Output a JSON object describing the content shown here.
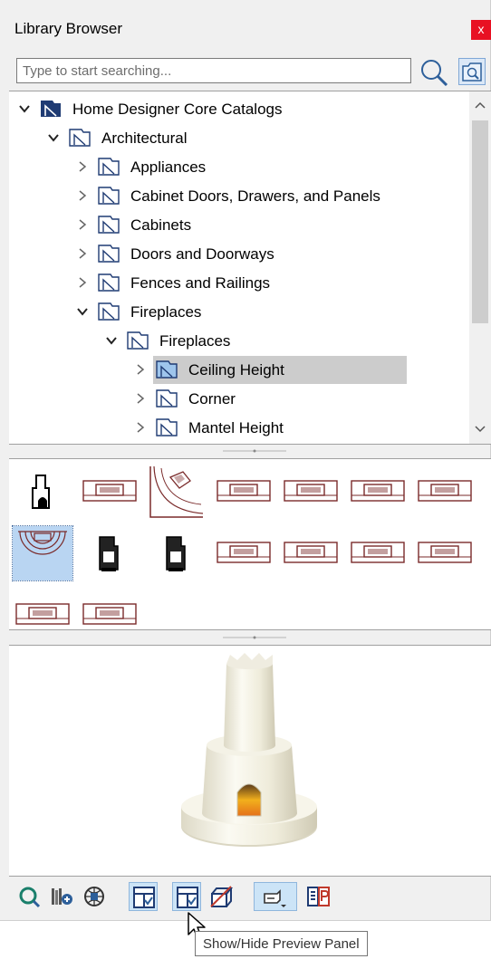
{
  "window": {
    "title": "Library Browser",
    "close_label": "x"
  },
  "search": {
    "placeholder": "Type to start searching..."
  },
  "tree": {
    "items": [
      {
        "label": "Home Designer Core Catalogs",
        "level": 0,
        "expanded": true,
        "selected": false,
        "root": true
      },
      {
        "label": "Architectural",
        "level": 1,
        "expanded": true,
        "selected": false
      },
      {
        "label": "Appliances",
        "level": 2,
        "expanded": false,
        "selected": false
      },
      {
        "label": "Cabinet Doors, Drawers, and Panels",
        "level": 2,
        "expanded": false,
        "selected": false
      },
      {
        "label": "Cabinets",
        "level": 2,
        "expanded": false,
        "selected": false
      },
      {
        "label": "Doors and Doorways",
        "level": 2,
        "expanded": false,
        "selected": false
      },
      {
        "label": "Fences and Railings",
        "level": 2,
        "expanded": false,
        "selected": false
      },
      {
        "label": "Fireplaces",
        "level": 2,
        "expanded": true,
        "selected": false
      },
      {
        "label": "Fireplaces",
        "level": 3,
        "expanded": true,
        "selected": false
      },
      {
        "label": "Ceiling Height",
        "level": 4,
        "expanded": false,
        "selected": true
      },
      {
        "label": "Corner",
        "level": 4,
        "expanded": false,
        "selected": false
      },
      {
        "label": "Mantel Height",
        "level": 4,
        "expanded": false,
        "selected": false
      }
    ]
  },
  "thumbnails": {
    "items": [
      {
        "kind": "fireplace-3d-icon",
        "selected": false
      },
      {
        "kind": "fireplace-plan-icon",
        "selected": false
      },
      {
        "kind": "corner-fireplace-plan-icon",
        "selected": false
      },
      {
        "kind": "fireplace-plan-icon",
        "selected": false
      },
      {
        "kind": "fireplace-plan-icon",
        "selected": false
      },
      {
        "kind": "fireplace-plan-icon",
        "selected": false
      },
      {
        "kind": "fireplace-plan-icon",
        "selected": false
      },
      {
        "kind": "round-fireplace-plan-icon",
        "selected": true
      },
      {
        "kind": "stove-3d-icon",
        "selected": false
      },
      {
        "kind": "stove-3d-icon",
        "selected": false
      },
      {
        "kind": "fireplace-plan-icon",
        "selected": false
      },
      {
        "kind": "fireplace-plan-icon",
        "selected": false
      },
      {
        "kind": "fireplace-plan-icon",
        "selected": false
      },
      {
        "kind": "fireplace-plan-icon",
        "selected": false
      },
      {
        "kind": "fireplace-plan-icon",
        "selected": false
      },
      {
        "kind": "fireplace-plan-icon",
        "selected": false
      }
    ]
  },
  "toolbar": {
    "buttons": [
      {
        "name": "refresh-library-icon",
        "active": false
      },
      {
        "name": "add-to-library-icon",
        "active": false
      },
      {
        "name": "online-catalogs-icon",
        "active": false
      },
      {
        "name": "show-hide-tree-panel-icon",
        "active": true
      },
      {
        "name": "show-hide-preview-panel-icon",
        "active": true
      },
      {
        "name": "material-options-icon",
        "active": false
      },
      {
        "name": "view-options-icon",
        "active": true
      },
      {
        "name": "library-properties-icon",
        "active": false
      }
    ]
  },
  "tooltip": {
    "text": "Show/Hide Preview Panel"
  },
  "colors": {
    "folder_root": "#1f3b73",
    "folder_line": "#1f3b73",
    "plan_line": "#7a2a2a",
    "selection": "#cccccc",
    "thumb_selection": "#b9d5f2",
    "close_red": "#e81123"
  }
}
